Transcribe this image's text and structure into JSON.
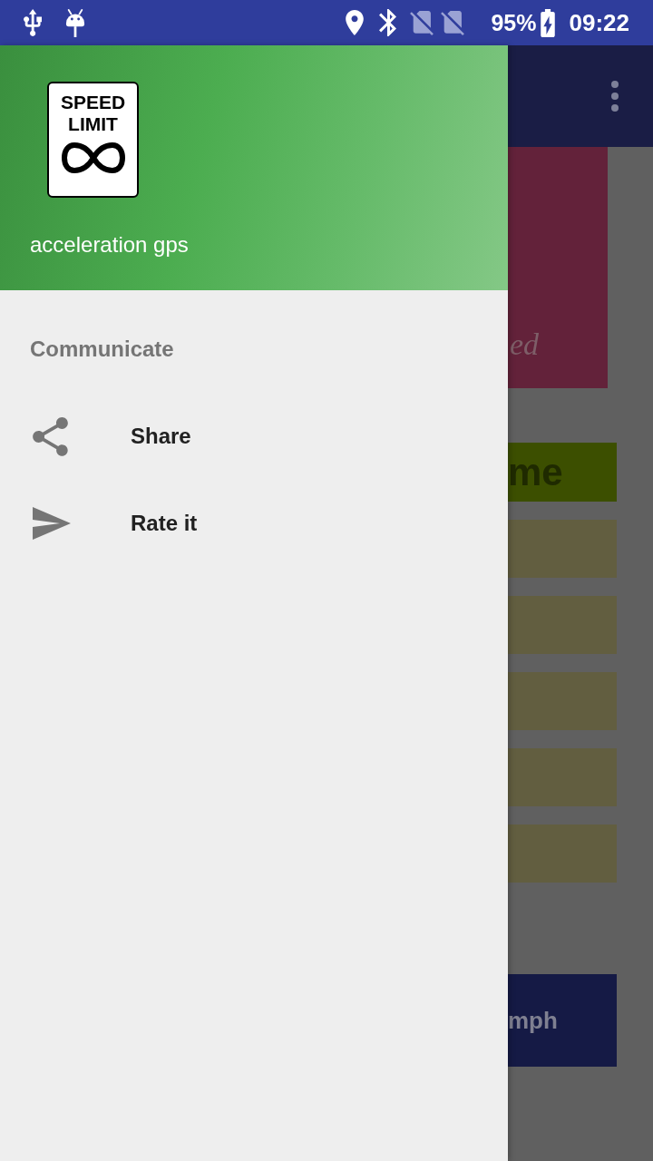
{
  "status_bar": {
    "battery": "95%",
    "time": "09:22"
  },
  "drawer": {
    "logo": {
      "line_1": "SPEED",
      "line_2": "LIMIT"
    },
    "title": "acceleration gps",
    "sections": [
      {
        "title": "Communicate",
        "items": [
          {
            "kind": "share",
            "label": "Share"
          },
          {
            "kind": "send",
            "label": "Rate it"
          }
        ]
      }
    ]
  },
  "background_screen": {
    "card_text": "ed",
    "heading": "me",
    "speed_unit": "mph"
  }
}
